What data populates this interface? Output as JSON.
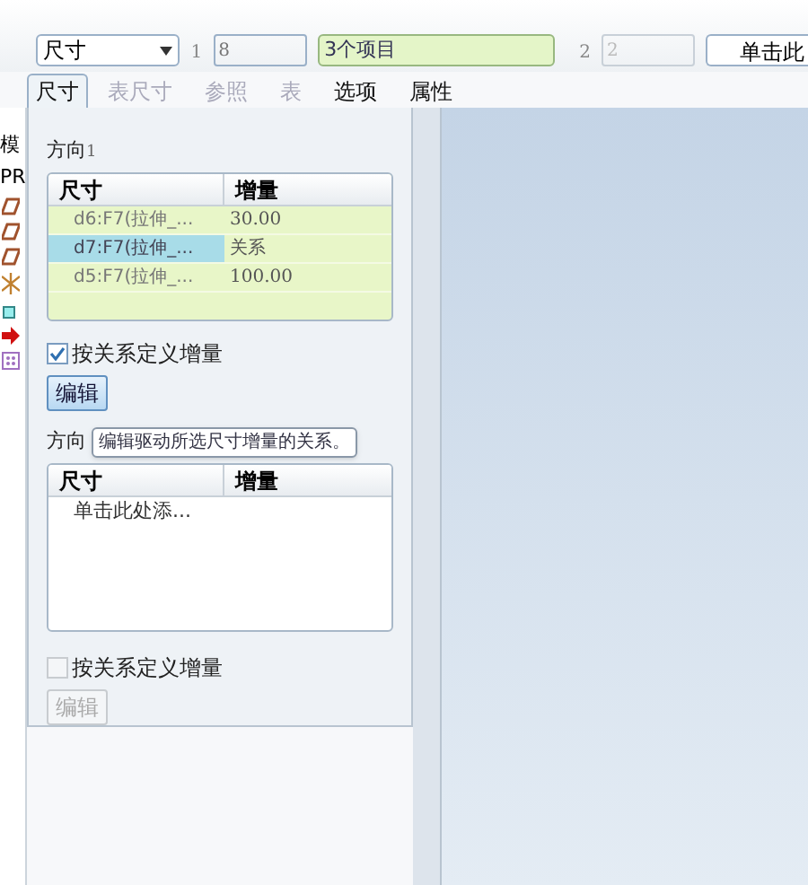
{
  "toolbar": {
    "dropdown": "尺寸",
    "field_1_label": "1",
    "field_1_value": "8",
    "items_field": "3个项目",
    "field_2_label": "2",
    "field_2_placeholder": "2",
    "button": "单击此"
  },
  "tabs": [
    {
      "label": "尺寸",
      "selected": true,
      "disabled": false
    },
    {
      "label": "表尺寸",
      "selected": false,
      "disabled": true
    },
    {
      "label": "参照",
      "selected": false,
      "disabled": true
    },
    {
      "label": "表",
      "selected": false,
      "disabled": true
    },
    {
      "label": "选项",
      "selected": false,
      "disabled": false
    },
    {
      "label": "属性",
      "selected": false,
      "disabled": false
    }
  ],
  "sidebar": {
    "items": [
      {
        "kind": "text",
        "label": "模"
      },
      {
        "kind": "text",
        "label": "PR"
      },
      {
        "kind": "plane"
      },
      {
        "kind": "plane"
      },
      {
        "kind": "plane"
      },
      {
        "kind": "axes"
      },
      {
        "kind": "box"
      },
      {
        "kind": "arrow"
      },
      {
        "kind": "grid"
      }
    ]
  },
  "direction_1": {
    "title": "方向",
    "index": "1",
    "columns": [
      "尺寸",
      "增量"
    ],
    "rows": [
      {
        "dimension": "d6:F7(拉伸_...",
        "increment": "30.00",
        "selected": false
      },
      {
        "dimension": "d7:F7(拉伸_...",
        "increment": "关系",
        "selected": true
      },
      {
        "dimension": "d5:F7(拉伸_...",
        "increment": "100.00",
        "selected": false
      }
    ],
    "checkbox": {
      "label": "按关系定义增量",
      "checked": true
    },
    "edit_button": {
      "label": "编辑",
      "disabled": false
    }
  },
  "direction_2": {
    "title": "方向",
    "columns": [
      "尺寸",
      "增量"
    ],
    "placeholder_row": "单击此处添...",
    "checkbox": {
      "label": "按关系定义增量",
      "checked": false
    },
    "edit_button": {
      "label": "编辑",
      "disabled": true
    }
  },
  "tooltip": "编辑驱动所选尺寸增量的关系。"
}
